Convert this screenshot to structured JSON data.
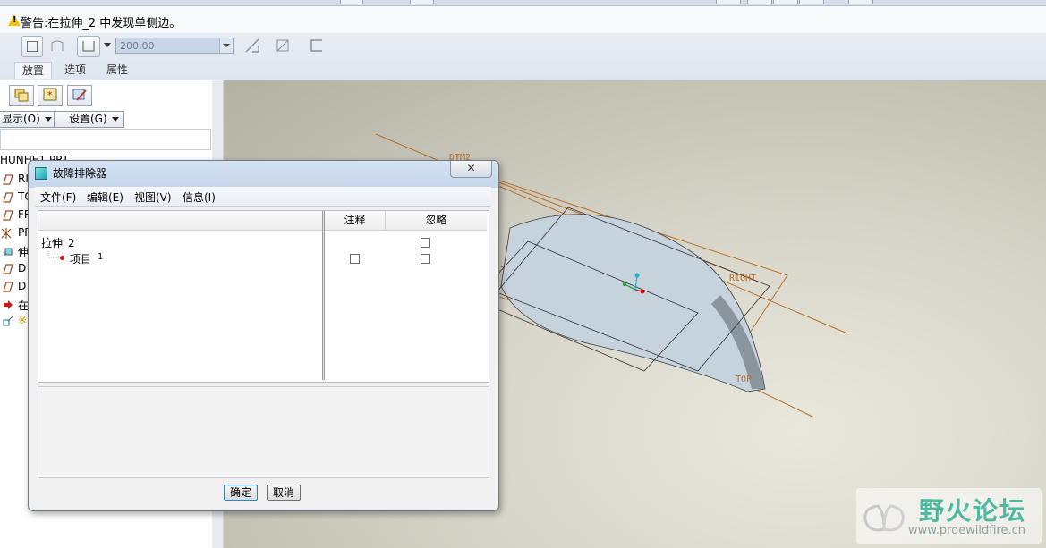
{
  "warning": {
    "text": "警告:在拉伸_2 中发现单侧边。"
  },
  "dashboard": {
    "depth_value": "200.00",
    "tabs": [
      {
        "label": "放置"
      },
      {
        "label": "选项"
      },
      {
        "label": "属性"
      }
    ]
  },
  "model_tree": {
    "show_label": "显示(O)",
    "settings_label": "设置(G)",
    "root": "HUNHE1.PRT",
    "items": [
      {
        "label": "RI",
        "icon": "datum-plane-icon"
      },
      {
        "label": "TO",
        "icon": "datum-plane-icon"
      },
      {
        "label": "FR",
        "icon": "datum-plane-icon"
      },
      {
        "label": "PR",
        "icon": "coordinate-system-icon"
      },
      {
        "label": "伸",
        "icon": "extrude-feature-icon"
      },
      {
        "label": "D",
        "icon": "datum-plane-icon"
      },
      {
        "label": "D",
        "icon": "datum-plane-icon"
      },
      {
        "label": "在",
        "icon": "insert-here-arrow-icon"
      },
      {
        "label": "※",
        "icon": "feature-in-progress-icon"
      }
    ]
  },
  "viewport": {
    "datum_labels": {
      "dtm2": "DTM2",
      "right": "RIGHT",
      "top": "TOP"
    },
    "colors": {
      "background": "#c9c7bb",
      "datum": "#b8702a",
      "solid": "#c6d2dc"
    }
  },
  "dialog": {
    "title": "故障排除器",
    "close": "✕",
    "menu": [
      {
        "label": "文件(F)"
      },
      {
        "label": "编辑(E)"
      },
      {
        "label": "视图(V)"
      },
      {
        "label": "信息(I)"
      }
    ],
    "columns": {
      "comment": "注释",
      "ignore": "忽略"
    },
    "rows": [
      {
        "label": "拉伸_2"
      },
      {
        "label": "项目",
        "index": "1"
      }
    ],
    "ok": "确定",
    "cancel": "取消"
  },
  "watermark": {
    "main": "野火论坛",
    "sub": "www.proewildfire.cn"
  }
}
